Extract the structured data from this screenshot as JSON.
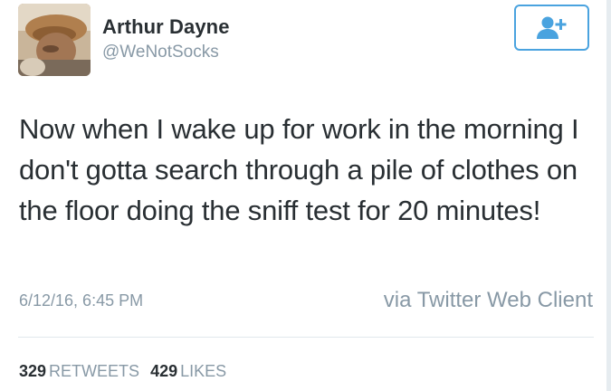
{
  "tweet": {
    "user": {
      "name": "Arthur Dayne",
      "handle": "@WeNotSocks"
    },
    "text": "Now when I wake up for work in the morning I don't gotta search through a pile of clothes on the floor doing the sniff test for 20 minutes!",
    "timestamp": "6/12/16, 6:45 PM",
    "source": "via Twitter Web Client",
    "stats": {
      "retweets_count": "329",
      "retweets_label": "RETWEETS",
      "likes_count": "429",
      "likes_label": "LIKES"
    }
  },
  "icons": {
    "follow": "add-user-icon",
    "avatar": "profile-photo"
  },
  "colors": {
    "accent": "#4aa3df",
    "text": "#292f33",
    "muted": "#8899a6",
    "divider": "#e1e8ed"
  }
}
